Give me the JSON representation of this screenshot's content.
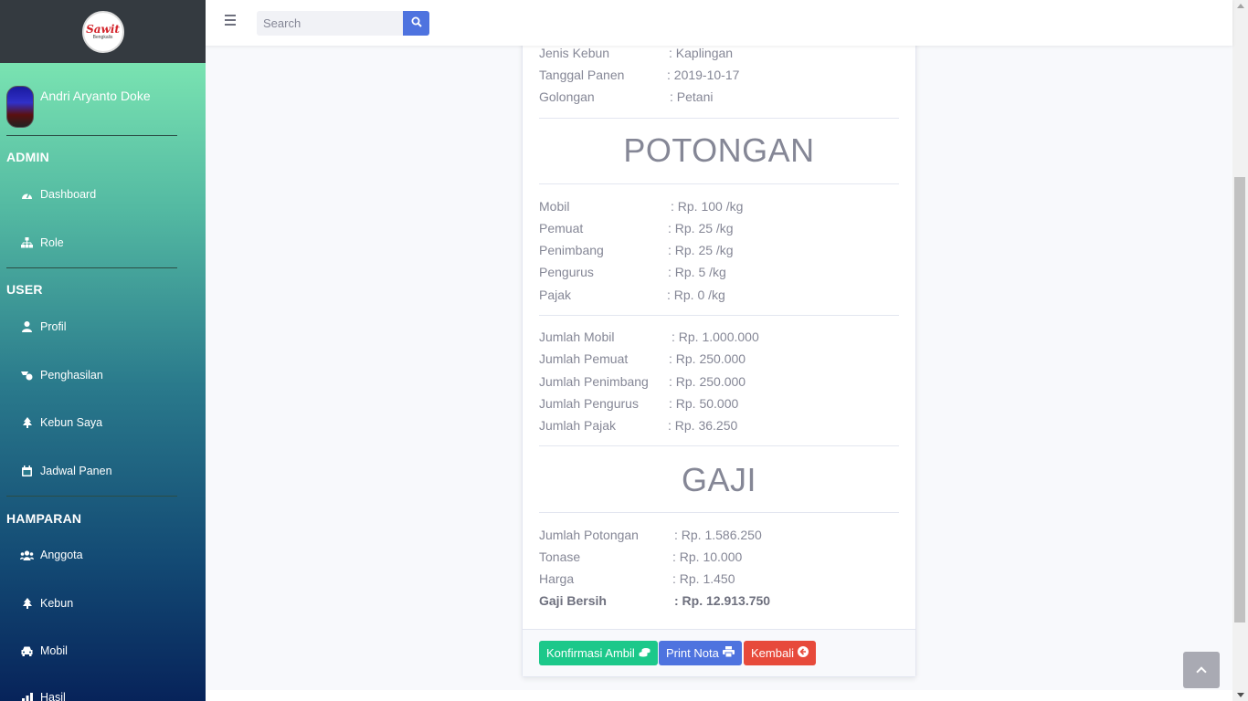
{
  "sidebar": {
    "logo_text": "Sawit",
    "logo_sub": "Bengkalis",
    "user_name": "Andri Aryanto Doke",
    "sections": [
      {
        "heading": "ADMIN",
        "items": [
          {
            "label": "Dashboard",
            "icon": "tachometer-icon"
          },
          {
            "label": "Role",
            "icon": "sitemap-icon"
          }
        ]
      },
      {
        "heading": "USER",
        "items": [
          {
            "label": "Profil",
            "icon": "user-icon"
          },
          {
            "label": "Penghasilan",
            "icon": "money-icon"
          },
          {
            "label": "Kebun Saya",
            "icon": "tree-icon"
          },
          {
            "label": "Jadwal Panen",
            "icon": "calendar-icon"
          }
        ]
      },
      {
        "heading": "HAMPARAN",
        "items": [
          {
            "label": "Anggota",
            "icon": "users-icon"
          },
          {
            "label": "Kebun",
            "icon": "tree-icon"
          },
          {
            "label": "Mobil",
            "icon": "car-icon"
          },
          {
            "label": "Hasil",
            "icon": "chart-icon"
          }
        ]
      }
    ]
  },
  "topbar": {
    "search_placeholder": "Search"
  },
  "card": {
    "info": [
      {
        "label": "Jenis Kebun",
        "value": ": Kaplingan"
      },
      {
        "label": "Tanggal Panen",
        "value": ": 2019-10-17"
      },
      {
        "label": "Golongan",
        "value": ": Petani"
      }
    ],
    "potongan_title": "POTONGAN",
    "potongan": [
      {
        "label": "Mobil",
        "value": ": Rp. 100 /kg"
      },
      {
        "label": "Pemuat",
        "value": ": Rp. 25 /kg"
      },
      {
        "label": "Penimbang",
        "value": ": Rp. 25 /kg"
      },
      {
        "label": "Pengurus",
        "value": ": Rp. 5 /kg"
      },
      {
        "label": "Pajak",
        "value": ": Rp. 0 /kg"
      }
    ],
    "jumlah": [
      {
        "label": "Jumlah Mobil",
        "value": ": Rp. 1.000.000"
      },
      {
        "label": "Jumlah Pemuat",
        "value": ": Rp. 250.000"
      },
      {
        "label": "Jumlah Penimbang",
        "value": ": Rp. 250.000"
      },
      {
        "label": "Jumlah Pengurus",
        "value": ": Rp. 50.000"
      },
      {
        "label": "Jumlah Pajak",
        "value": ": Rp. 36.250"
      }
    ],
    "gaji_title": "GAJI",
    "gaji": [
      {
        "label": "Jumlah Potongan",
        "value": ": Rp. 1.586.250"
      },
      {
        "label": "Tonase",
        "value": ": Rp. 10.000"
      },
      {
        "label": "Harga",
        "value": ": Rp. 1.450"
      },
      {
        "label": "Gaji Bersih",
        "value": ": Rp. 12.913.750"
      }
    ],
    "buttons": {
      "confirm": "Konfirmasi Ambil",
      "print": "Print Nota",
      "back": "Kembali"
    }
  },
  "colors": {
    "primary": "#4e73df",
    "success": "#1cc88a",
    "danger": "#e74a3b"
  }
}
